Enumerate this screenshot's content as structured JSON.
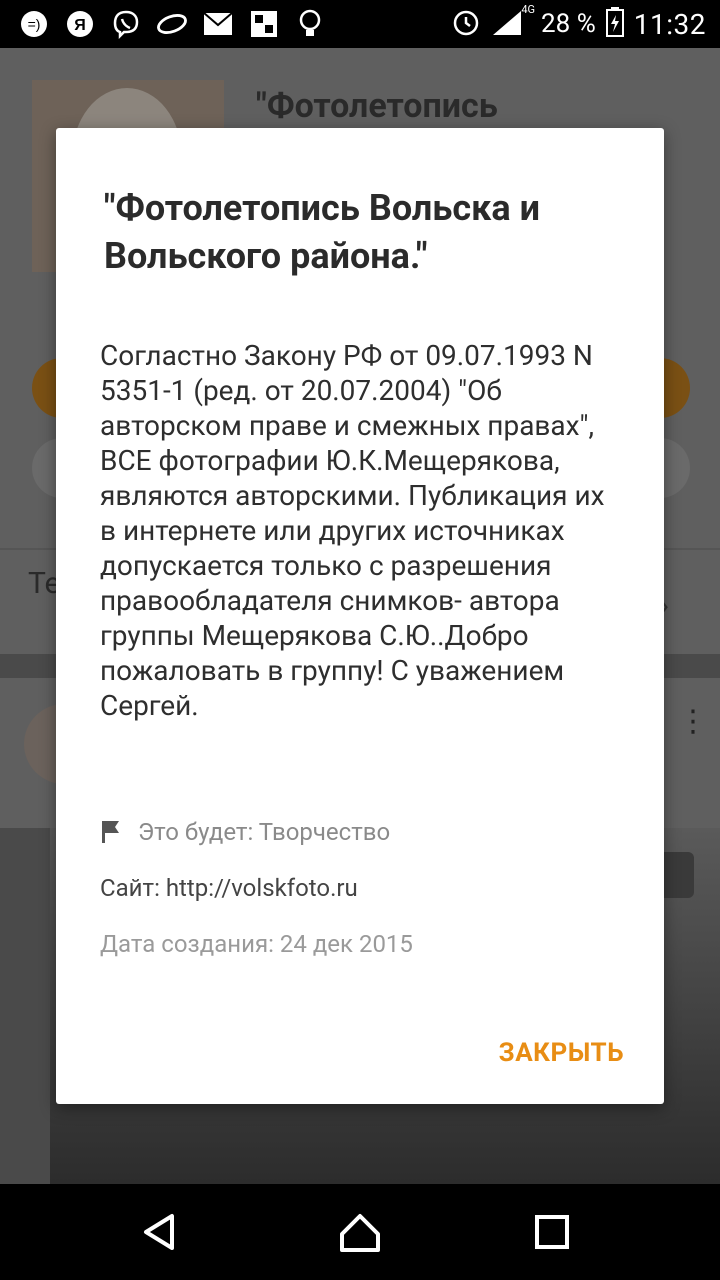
{
  "status_bar": {
    "battery_percent": "28 %",
    "network": "4G",
    "time": "11:32",
    "notification_icons": [
      "messenger-icon",
      "yandex-icon",
      "viber-icon",
      "browser-icon",
      "mail-icon",
      "gallery-icon",
      "bulb-icon"
    ],
    "system_icons": [
      "alarm-icon",
      "signal-icon",
      "battery-icon"
    ]
  },
  "background_page": {
    "group_title": "\"Фотолетопись",
    "tab_partial": "Те"
  },
  "dialog": {
    "title": "\"Фотолетопись Вольска и Вольского района.\"",
    "body": "Согластно Закону РФ от 09.07.1993 N 5351-1 (ред. от 20.07.2004) \"Об авторском праве и смежных правах\", ВСЕ фотографии Ю.К.Мещерякова, являются авторскими. Публикация их в интернете или других источниках допускается только с разрешения правообладателя снимков- автора группы Мещерякова С.Ю..Добро пожаловать в группу! С уважением Сергей.",
    "category": "Это будет: Творчество",
    "site": "Сайт: http://volskfoto.ru",
    "created": "Дата создания: 24 дек 2015",
    "close_label": "ЗАКРЫТЬ"
  },
  "colors": {
    "accent": "#e88d14",
    "dialog_bg": "#ffffff",
    "scrim": "#5f5f5f"
  }
}
